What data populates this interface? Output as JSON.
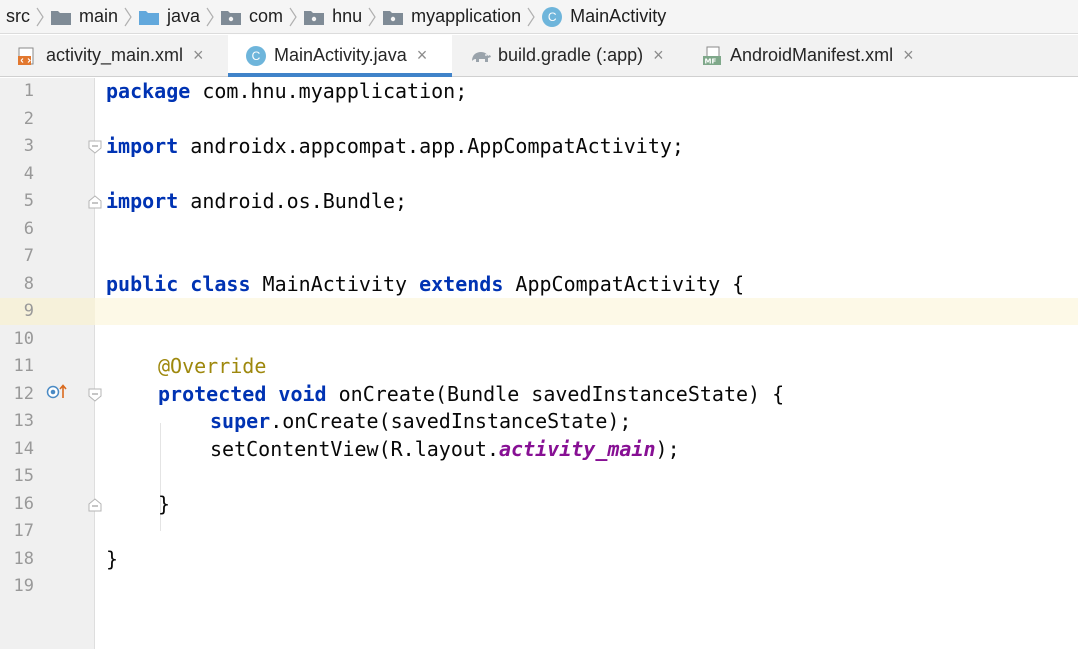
{
  "breadcrumb": {
    "items": [
      {
        "label": "src",
        "icon": null
      },
      {
        "label": "main",
        "icon": "folder-icon"
      },
      {
        "label": "java",
        "icon": "source-folder-icon"
      },
      {
        "label": "com",
        "icon": "package-icon"
      },
      {
        "label": "hnu",
        "icon": "package-icon"
      },
      {
        "label": "myapplication",
        "icon": "package-icon"
      },
      {
        "label": "MainActivity",
        "icon": "class-icon"
      }
    ]
  },
  "tabs": [
    {
      "label": "activity_main.xml",
      "icon": "xml-layout-icon",
      "active": false
    },
    {
      "label": "MainActivity.java",
      "icon": "class-icon",
      "active": true
    },
    {
      "label": "build.gradle (:app)",
      "icon": "gradle-icon",
      "active": false
    },
    {
      "label": "AndroidManifest.xml",
      "icon": "manifest-icon",
      "active": false
    }
  ],
  "editor": {
    "current_line": 9,
    "line_numbers": [
      "1",
      "2",
      "3",
      "4",
      "5",
      "6",
      "7",
      "8",
      "9",
      "10",
      "11",
      "12",
      "13",
      "14",
      "15",
      "16",
      "17",
      "18",
      "19"
    ],
    "code": {
      "l1_kw": "package",
      "l1_rest": " com.hnu.myapplication;",
      "l3_kw": "import",
      "l3_rest": " androidx.appcompat.app.AppCompatActivity;",
      "l5_kw": "import",
      "l5_rest": " android.os.Bundle;",
      "l8_kw1": "public",
      "l8_kw2": "class",
      "l8_name": " MainActivity ",
      "l8_kw3": "extends",
      "l8_rest": " AppCompatActivity {",
      "l11_ann": "@Override",
      "l12_kw1": "protected",
      "l12_kw2": "void",
      "l12_rest": " onCreate(Bundle savedInstanceState) {",
      "l13_kw": "super",
      "l13_rest": ".onCreate(savedInstanceState);",
      "l14_a": "setContentView(R.layout.",
      "l14_ital": "activity_main",
      "l14_b": ");",
      "l16": "}",
      "l18": "}"
    }
  },
  "colors": {
    "keyword": "#0033b3",
    "annotation": "#9e880d",
    "static_field": "#871094",
    "tab_active_underline": "#4083c9",
    "current_line": "#fdf9e7"
  }
}
